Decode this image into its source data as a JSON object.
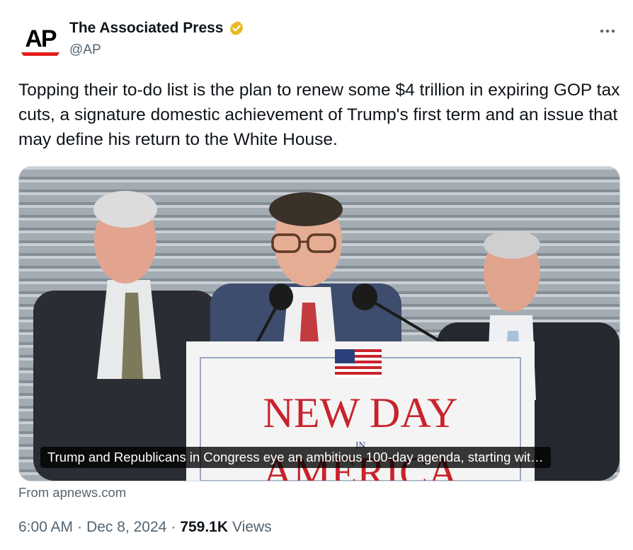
{
  "author": {
    "name": "The Associated Press",
    "handle": "@AP",
    "logo_text": "AP",
    "verified_color": "#e8b923"
  },
  "tweet": {
    "text": "Topping their to-do list is the plan to renew some $4 trillion in expiring GOP tax cuts, a signature domestic achievement of Trump's first term and an issue that may define his return to the White House."
  },
  "card": {
    "caption": "Trump and Republicans in Congress eye an ambitious 100-day agenda, starting wit…",
    "sign_line1": "NEW DAY",
    "sign_line2": "IN",
    "sign_line3": "AMERICA",
    "source": "From apnews.com"
  },
  "meta": {
    "time": "6:00 AM",
    "date": "Dec 8, 2024",
    "views_count": "759.1K",
    "views_label": "Views"
  },
  "icons": {
    "more": "more-dots-icon",
    "verified": "verified-badge-icon"
  },
  "colors": {
    "text_primary": "#0f1419",
    "text_secondary": "#536471",
    "ap_red": "#e31d1a",
    "sign_red": "#c8232c"
  }
}
